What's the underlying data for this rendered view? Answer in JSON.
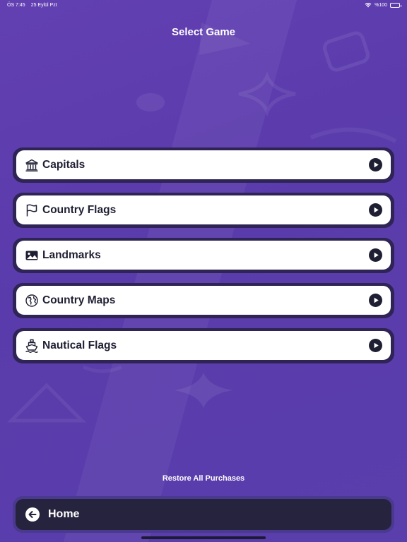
{
  "status_bar": {
    "time": "ÖS 7:45",
    "date": "25 Eylül Pzt",
    "battery_text": "%100",
    "battery_level": 1.0
  },
  "header": {
    "title": "Select Game"
  },
  "games": [
    {
      "label": "Capitals",
      "icon": "bank-icon"
    },
    {
      "label": "Country Flags",
      "icon": "flag-icon"
    },
    {
      "label": "Landmarks",
      "icon": "image-icon"
    },
    {
      "label": "Country Maps",
      "icon": "globe-icon"
    },
    {
      "label": "Nautical Flags",
      "icon": "ship-icon"
    }
  ],
  "restore": {
    "label": "Restore All Purchases"
  },
  "home": {
    "label": "Home",
    "icon": "arrow-left-icon"
  },
  "colors": {
    "background": "#5e3eae",
    "card_border": "#2e2455",
    "card_fill": "#ffffff",
    "text_dark": "#1f1f33",
    "home_fill": "#25233d"
  }
}
